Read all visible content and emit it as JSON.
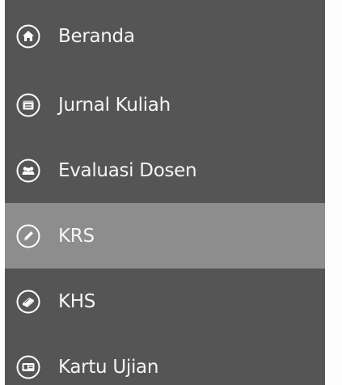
{
  "sidebar": {
    "items": [
      {
        "label": "Beranda",
        "icon": "home-icon"
      },
      {
        "label": "Jurnal Kuliah",
        "icon": "calendar-icon"
      },
      {
        "label": "Evaluasi Dosen",
        "icon": "users-icon"
      },
      {
        "label": "KRS",
        "icon": "pencil-icon",
        "active": true
      },
      {
        "label": "KHS",
        "icon": "book-icon"
      },
      {
        "label": "Kartu Ujian",
        "icon": "id-card-icon"
      }
    ]
  },
  "colors": {
    "sidebar_bg": "#555555",
    "active_bg": "#8d8d8d",
    "text": "#ffffff"
  }
}
